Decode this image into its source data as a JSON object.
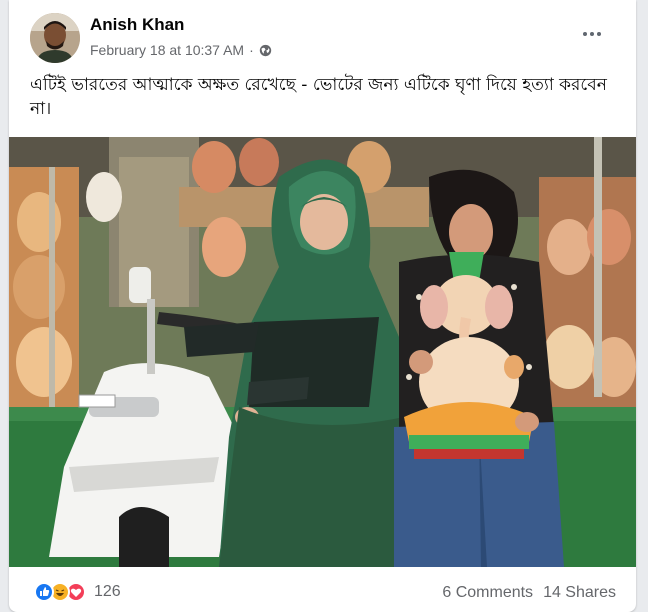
{
  "post": {
    "author": "Anish Khan",
    "timestamp": "February 18 at 10:37 AM",
    "separator": "·",
    "privacy_icon": "globe-icon",
    "more_icon": "more-options-icon",
    "text": "এটিই ভারতের আত্মাকে অক্ষত রেখেছে - ভোটের জন্য এটিকে ঘৃণা দিয়ে হত্যা করবেন না।"
  },
  "footer": {
    "reaction_icons": [
      "like-icon",
      "haha-icon",
      "love-icon"
    ],
    "reaction_count": "126",
    "comments": "6 Comments",
    "shares": "14 Shares"
  },
  "colors": {
    "like": "#1877f2",
    "haha": "#f7b125",
    "love": "#f33e58",
    "secondary_text": "#65676b"
  }
}
